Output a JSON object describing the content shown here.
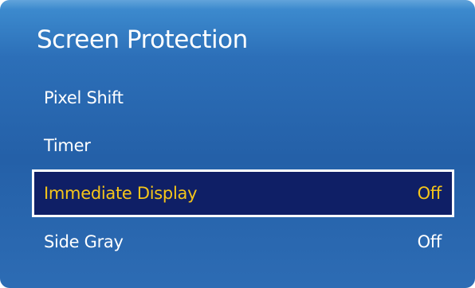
{
  "title": "Screen Protection",
  "menu": {
    "items": [
      {
        "label": "Pixel Shift",
        "value": ""
      },
      {
        "label": "Timer",
        "value": ""
      },
      {
        "label": "Immediate Display",
        "value": "Off"
      },
      {
        "label": "Side Gray",
        "value": "Off"
      }
    ],
    "selected_index": 2
  },
  "colors": {
    "panel_top": "#3f8fd2",
    "panel_body": "#2460a8",
    "selected_bg": "#0f1f66",
    "selected_text": "#f5c51a",
    "text": "#ffffff"
  }
}
